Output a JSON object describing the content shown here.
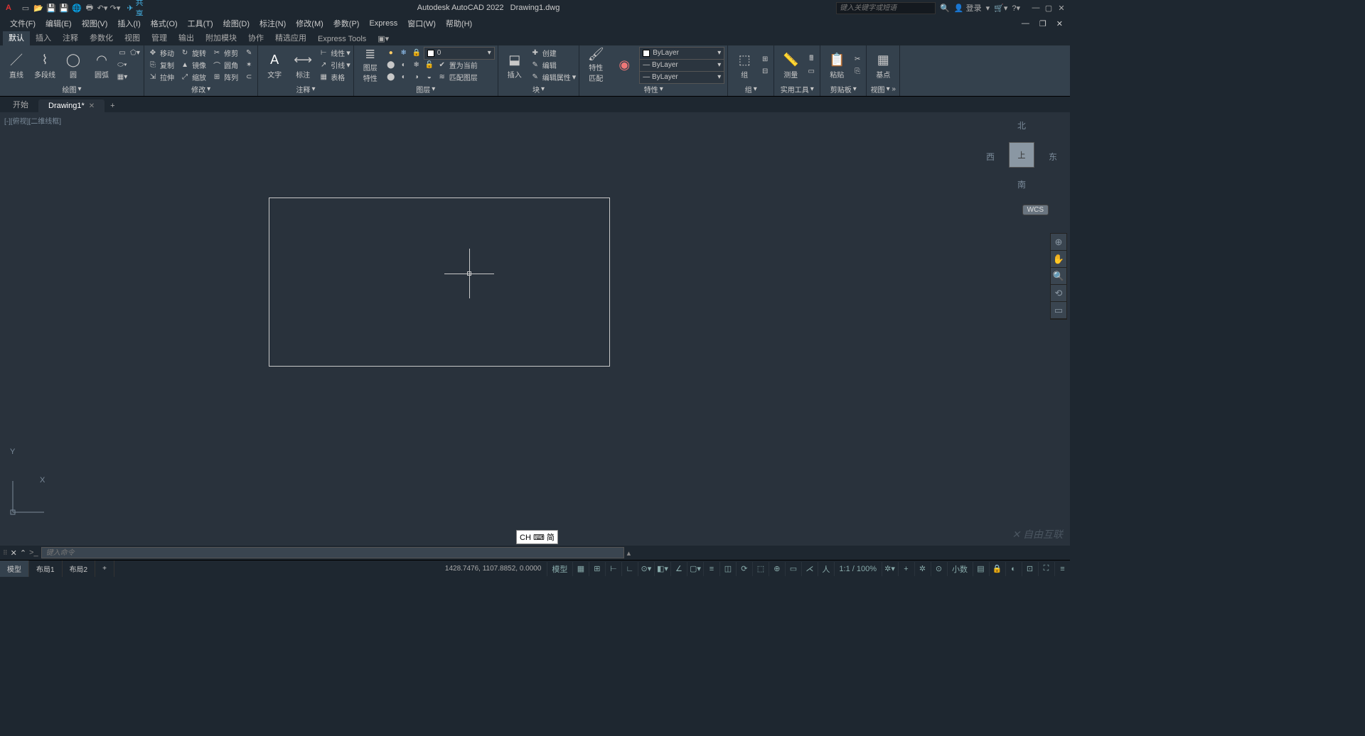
{
  "title": {
    "app": "Autodesk AutoCAD 2022",
    "file": "Drawing1.dwg"
  },
  "share": "共享",
  "search_placeholder": "键入关键字或短语",
  "login": "登录",
  "menus": [
    "文件(F)",
    "编辑(E)",
    "视图(V)",
    "插入(I)",
    "格式(O)",
    "工具(T)",
    "绘图(D)",
    "标注(N)",
    "修改(M)",
    "参数(P)",
    "Express",
    "窗口(W)",
    "帮助(H)"
  ],
  "ribbon_tabs": [
    "默认",
    "插入",
    "注释",
    "参数化",
    "视图",
    "管理",
    "输出",
    "附加模块",
    "协作",
    "精选应用",
    "Express Tools"
  ],
  "panels": {
    "draw": {
      "title": "绘图",
      "line": "直线",
      "pline": "多段线",
      "circle": "圆",
      "arc": "圆弧"
    },
    "modify": {
      "title": "修改",
      "move": "移动",
      "rotate": "旋转",
      "trim": "修剪",
      "copy": "复制",
      "mirror": "镜像",
      "fillet": "圆角",
      "stretch": "拉伸",
      "scale": "缩放",
      "array": "阵列"
    },
    "annot": {
      "title": "注释",
      "text": "文字",
      "label": "标注",
      "linear": "线性",
      "leader": "引线",
      "table": "表格"
    },
    "layer": {
      "title": "图层",
      "props": "图层\n特性",
      "cur": "0",
      "setcurrent": "置为当前",
      "match": "匹配图层"
    },
    "block": {
      "title": "块",
      "insert": "插入",
      "create": "创建",
      "edit": "编辑",
      "editattr": "编辑属性"
    },
    "props": {
      "title": "特性",
      "match": "特性\n匹配",
      "bylayer": "ByLayer"
    },
    "group": {
      "title": "组",
      "label": "组"
    },
    "util": {
      "title": "实用工具",
      "label": "测量"
    },
    "clip": {
      "title": "剪贴板",
      "label": "粘贴"
    },
    "view": {
      "title": "视图",
      "label": "基点"
    }
  },
  "doctabs": {
    "start": "开始",
    "drawing": "Drawing1*"
  },
  "viewport_label": "[-][俯视][二维线框]",
  "viewcube": {
    "n": "北",
    "s": "南",
    "e": "东",
    "w": "西",
    "top": "上",
    "wcs": "WCS"
  },
  "cmd": {
    "prompt": ">_",
    "placeholder": "键入命令"
  },
  "ime": "CH ⌨ 简",
  "status": {
    "tabs": [
      "模型",
      "布局1",
      "布局2"
    ],
    "coords": "1428.7476, 1107.8852, 0.0000",
    "model": "模型",
    "scale": "1:1 / 100%",
    "decimal": "小数"
  },
  "watermark": "自由互联",
  "ucs": {
    "x": "X",
    "y": "Y"
  }
}
